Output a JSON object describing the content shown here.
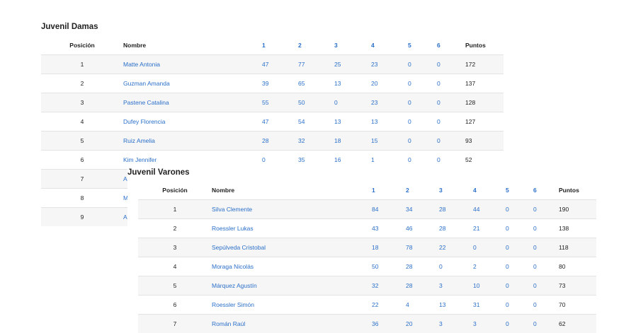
{
  "damas": {
    "title": "Juvenil Damas",
    "headers": [
      "Posición",
      "Nombre",
      "1",
      "2",
      "3",
      "4",
      "5",
      "6",
      "Puntos"
    ],
    "rows": [
      [
        "1",
        "Matte Antonia",
        "47",
        "77",
        "25",
        "23",
        "0",
        "0",
        "172"
      ],
      [
        "2",
        "Guzman Amanda",
        "39",
        "65",
        "13",
        "20",
        "0",
        "0",
        "137"
      ],
      [
        "3",
        "Pastene Catalina",
        "55",
        "50",
        "0",
        "23",
        "0",
        "0",
        "128"
      ],
      [
        "4",
        "Dufey Florencia",
        "47",
        "54",
        "13",
        "13",
        "0",
        "0",
        "127"
      ],
      [
        "5",
        "Ruiz Amelia",
        "28",
        "32",
        "18",
        "15",
        "0",
        "0",
        "93"
      ],
      [
        "6",
        "Kim Jennifer",
        "0",
        "35",
        "16",
        "1",
        "0",
        "0",
        "52"
      ],
      [
        "7",
        "A",
        "",
        "",
        "",
        "",
        "",
        "",
        ""
      ],
      [
        "8",
        "M",
        "",
        "",
        "",
        "",
        "",
        "",
        ""
      ],
      [
        "9",
        "A",
        "",
        "",
        "",
        "",
        "",
        "",
        ""
      ]
    ]
  },
  "varones": {
    "title": "Juvenil Varones",
    "headers": [
      "Posición",
      "Nombre",
      "1",
      "2",
      "3",
      "4",
      "5",
      "6",
      "Puntos"
    ],
    "rows": [
      [
        "1",
        "Silva Clemente",
        "84",
        "34",
        "28",
        "44",
        "0",
        "0",
        "190"
      ],
      [
        "2",
        "Roessler Lukas",
        "43",
        "46",
        "28",
        "21",
        "0",
        "0",
        "138"
      ],
      [
        "3",
        "Sepúlveda Cristobal",
        "18",
        "78",
        "22",
        "0",
        "0",
        "0",
        "118"
      ],
      [
        "4",
        "Moraga Nicolás",
        "50",
        "28",
        "0",
        "2",
        "0",
        "0",
        "80"
      ],
      [
        "5",
        "Márquez Agustín",
        "32",
        "28",
        "3",
        "10",
        "0",
        "0",
        "73"
      ],
      [
        "6",
        "Roessler Simón",
        "22",
        "4",
        "13",
        "31",
        "0",
        "0",
        "70"
      ],
      [
        "7",
        "Román Raúl",
        "36",
        "20",
        "3",
        "3",
        "0",
        "0",
        "62"
      ]
    ]
  },
  "colors": {
    "link": "#2a6fc9",
    "stripe": "#f6f6f6",
    "border": "#e3e3e3"
  }
}
